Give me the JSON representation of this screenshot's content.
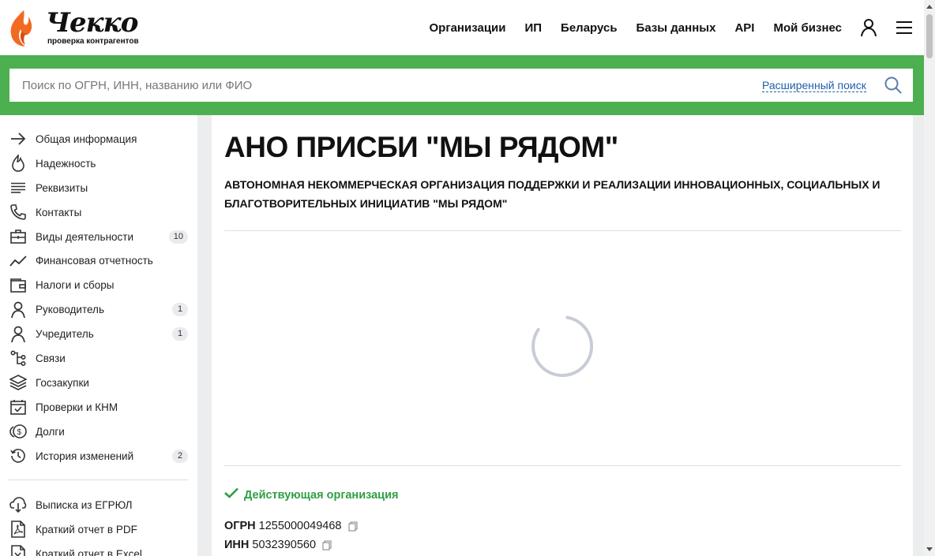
{
  "brand": {
    "name": "Чекко",
    "tagline": "проверка контрагентов",
    "colors": {
      "accent": "#4caf50",
      "logo_orange": "#f26a21",
      "status_green": "#2e9e43",
      "link_blue": "#1f5fa9"
    }
  },
  "nav": {
    "items": [
      "Организации",
      "ИП",
      "Беларусь",
      "Базы данных",
      "API",
      "Мой бизнес"
    ],
    "icons": [
      "user-icon",
      "menu-icon"
    ]
  },
  "search": {
    "placeholder": "Поиск по ОГРН, ИНН, названию или ФИО",
    "advanced_label": "Расширенный поиск",
    "icon": "search-icon"
  },
  "sidebar": {
    "items": [
      {
        "label": "Общая информация",
        "icon": "arrow-right-icon",
        "badge": ""
      },
      {
        "label": "Надежность",
        "icon": "flame-icon",
        "badge": ""
      },
      {
        "label": "Реквизиты",
        "icon": "lines-icon",
        "badge": ""
      },
      {
        "label": "Контакты",
        "icon": "phone-icon",
        "badge": ""
      },
      {
        "label": "Виды деятельности",
        "icon": "briefcase-icon",
        "badge": "10"
      },
      {
        "label": "Финансовая отчетность",
        "icon": "trend-icon",
        "badge": ""
      },
      {
        "label": "Налоги и сборы",
        "icon": "wallet-icon",
        "badge": ""
      },
      {
        "label": "Руководитель",
        "icon": "person-icon",
        "badge": "1"
      },
      {
        "label": "Учредитель",
        "icon": "person-icon",
        "badge": "1"
      },
      {
        "label": "Связи",
        "icon": "links-icon",
        "badge": ""
      },
      {
        "label": "Госзакупки",
        "icon": "layers-icon",
        "badge": ""
      },
      {
        "label": "Проверки и КНМ",
        "icon": "calendar-check-icon",
        "badge": ""
      },
      {
        "label": "Долги",
        "icon": "coins-icon",
        "badge": ""
      },
      {
        "label": "История изменений",
        "icon": "history-icon",
        "badge": "2"
      }
    ],
    "documents": [
      {
        "label": "Выписка из ЕГРЮЛ",
        "icon": "download-cloud-icon"
      },
      {
        "label": "Краткий отчет в PDF",
        "icon": "pdf-icon"
      },
      {
        "label": "Краткий отчет в Excel",
        "icon": "excel-icon"
      }
    ]
  },
  "org": {
    "short_name": "АНО ПРИСБИ \"МЫ РЯДОМ\"",
    "full_name": "АВТОНОМНАЯ НЕКОММЕРЧЕСКАЯ ОРГАНИЗАЦИЯ ПОДДЕРЖКИ И РЕАЛИЗАЦИИ ИННОВАЦИОННЫХ, СОЦИАЛЬНЫХ И БЛАГОТВОРИТЕЛЬНЫХ ИНИЦИАТИВ \"МЫ РЯДОМ\"",
    "status": "Действующая организация",
    "ogrn_label": "ОГРН",
    "ogrn": "1255000049468",
    "inn_label": "ИНН",
    "inn": "5032390560"
  }
}
